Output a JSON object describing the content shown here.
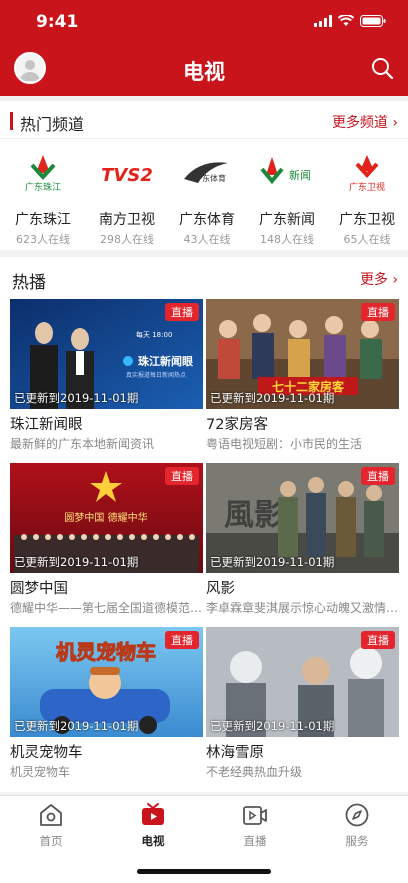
{
  "status": {
    "time": "9:41"
  },
  "header": {
    "title": "电视"
  },
  "channels": {
    "title": "热门频道",
    "more": "更多频道 ›",
    "items": [
      {
        "name": "广东珠江",
        "online": "623人在线",
        "logo_text": "广东珠江",
        "logo_color": "#1a8a3a"
      },
      {
        "name": "南方卫视",
        "online": "298人在线",
        "logo_text": "TVS2",
        "logo_color": "#e2231a"
      },
      {
        "name": "广东体育",
        "online": "43人在线",
        "logo_text": "广东体育",
        "logo_color": "#333333"
      },
      {
        "name": "广东新闻",
        "online": "148人在线",
        "logo_text": "新闻",
        "logo_color": "#1a8a3a"
      },
      {
        "name": "广东卫视",
        "online": "65人在线",
        "logo_text": "广东卫视",
        "logo_color": "#e2231a"
      }
    ]
  },
  "hot": {
    "title": "热播",
    "more": "更多 ›",
    "live_label": "直播",
    "items": [
      {
        "title": "珠江新闻眼",
        "subtitle": "最新鲜的广东本地新闻资讯",
        "update": "已更新到2019-11-01期",
        "banner": "珠江新闻眼",
        "banner_sub": "真实报道每日新闻热点",
        "banner_top": "每天 18:00"
      },
      {
        "title": "72家房客",
        "subtitle": "粤语电视短剧：小市民的生活",
        "update": "已更新到2019-11-01期",
        "banner": "七十二家房客"
      },
      {
        "title": "圆梦中国",
        "subtitle": "德耀中华——第七届全国道德模范…",
        "update": "已更新到2019-11-01期",
        "banner": "圆梦中国 德耀中华"
      },
      {
        "title": "风影",
        "subtitle": "李卓霖章斐淇展示惊心动魄又激情…",
        "update": "已更新到2019-11-01期",
        "banner": "風影"
      },
      {
        "title": "机灵宠物车",
        "subtitle": "机灵宠物车",
        "update": "已更新到2019-11-01期",
        "banner": "机灵宠物车"
      },
      {
        "title": "林海雪原",
        "subtitle": "不老经典热血升级",
        "update": "已更新到2019-11-01期",
        "banner": ""
      }
    ]
  },
  "tabs": [
    {
      "label": "首页",
      "icon": "home-icon"
    },
    {
      "label": "电视",
      "icon": "tv-icon"
    },
    {
      "label": "直播",
      "icon": "live-icon"
    },
    {
      "label": "服务",
      "icon": "compass-icon"
    }
  ],
  "colors": {
    "brand": "#c9141c",
    "tag": "#e3262e"
  }
}
